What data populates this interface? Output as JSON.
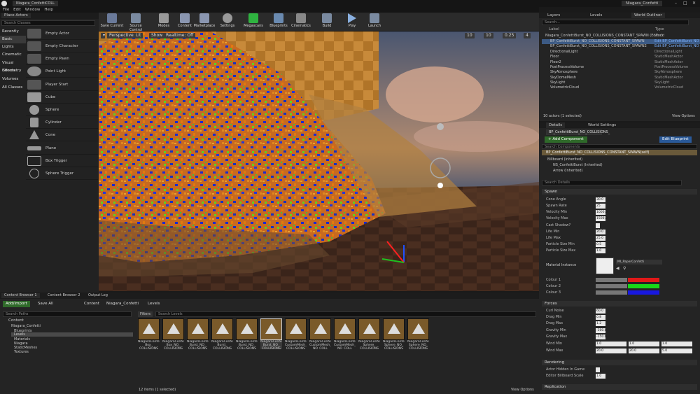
{
  "titlebar": {
    "tab": "Niagara_ConfettiCOLL",
    "app": "Niagara_Confetti"
  },
  "menu": [
    "File",
    "Edit",
    "Window",
    "Help"
  ],
  "place_actors": {
    "tab": "Place Actors",
    "search_placeholder": "Search Classes",
    "categories": [
      "Recently Placed",
      "Basic",
      "Lights",
      "Cinematic",
      "Visual Effects",
      "Geometry",
      "Volumes",
      "All Classes"
    ],
    "items": [
      "Empty Actor",
      "Empty Character",
      "Empty Pawn",
      "Point Light",
      "Player Start",
      "Cube",
      "Sphere",
      "Cylinder",
      "Cone",
      "Plane",
      "Box Trigger",
      "Sphere Trigger"
    ]
  },
  "toolbar": [
    "Save Current",
    "Source Control",
    "Modes",
    "Content",
    "Marketplace",
    "Settings",
    "Megascans",
    "Blueprints",
    "Cinematics",
    "Build",
    "Play",
    "Launch"
  ],
  "viewport": {
    "perspective": "Perspective",
    "lit": "Lit",
    "show": "Show",
    "realtime": "Realtime: Off",
    "snap1": "10",
    "snap2": "10",
    "snap3": "0.25",
    "snap4": "4"
  },
  "outliner": {
    "tabs": [
      "Layers",
      "Levels",
      "World Outliner"
    ],
    "search_placeholder": "Search...",
    "col_label": "Label",
    "col_type": "Type",
    "rows": [
      {
        "label": "Niagara_ConfettiBurst_NO_COLLISIONS_CONSTANT_SPAWN (Editor)",
        "type": "World"
      },
      {
        "label": "BP_ConfettiBurst_NO_COLLISIONS_CONSTANT_SPAWN",
        "type": "Edit BP_ConfettiBurst_NO"
      },
      {
        "label": "BP_ConfettiBurst_NO_COLLISIONS_CONSTANT_SPAWN2",
        "type": "Edit BP_ConfettiBurst_NO"
      },
      {
        "label": "DirectionalLight",
        "type": "DirectionalLight"
      },
      {
        "label": "Floor",
        "type": "StaticMeshActor"
      },
      {
        "label": "Floor2",
        "type": "StaticMeshActor"
      },
      {
        "label": "PostProcessVolume",
        "type": "PostProcessVolume"
      },
      {
        "label": "SkyAtmosphere",
        "type": "SkyAtmosphere"
      },
      {
        "label": "SkyDomeMesh",
        "type": "StaticMeshActor"
      },
      {
        "label": "SkyLight",
        "type": "SkyLight"
      },
      {
        "label": "VolumetricCloud",
        "type": "VolumetricCloud"
      }
    ],
    "count": "10 actors (1 selected)",
    "view_options": "View Options"
  },
  "details": {
    "tabs": [
      "Details",
      "World Settings"
    ],
    "name": "BP_ConfettiBurst_NO_COLLISIONS_",
    "add_component": "+ Add Component",
    "edit_blueprint": "Edit Blueprint",
    "search_comp_placeholder": "Search Components",
    "self_row": "BP_ConfettiBurst_NO_COLLISIONS_CONSTANT_SPAWN(self)",
    "components": [
      "Billboard (Inherited)",
      "NS_ConfettiBurst (Inherited)",
      "Arrow (Inherited)"
    ],
    "search_details_placeholder": "Search Details",
    "spawn_header": "Spawn",
    "spawn": [
      {
        "label": "Cone Angle",
        "value": "30.0"
      },
      {
        "label": "Spawn Rate",
        "value": "25"
      },
      {
        "label": "Velocity Min",
        "value": "1000.0"
      },
      {
        "label": "Velocity Max",
        "value": "1500.0"
      },
      {
        "label": "Cast Shadow?",
        "value": ""
      },
      {
        "label": "Life Min",
        "value": "20.0"
      },
      {
        "label": "Life Max",
        "value": "25.0"
      },
      {
        "label": "Particle Size Min",
        "value": "0.5"
      },
      {
        "label": "Particle Size Max",
        "value": "1.0"
      }
    ],
    "material_label": "Material Instance",
    "material_value": "MI_PaperConfetti",
    "colours": [
      "Colour 1",
      "Colour 2",
      "Colour 3"
    ],
    "colour_hex": [
      "#e01818",
      "#18d818",
      "#1818e0"
    ],
    "forces_header": "Forces",
    "forces": [
      {
        "label": "Curl Noise",
        "value": "60.0"
      },
      {
        "label": "Drag Min",
        "value": "0.8"
      },
      {
        "label": "Drag Max",
        "value": "1.2"
      },
      {
        "label": "Gravity Min",
        "value": "-100.0"
      },
      {
        "label": "Gravity Max",
        "value": "-150.0"
      }
    ],
    "wind_min": {
      "label": "Wind Min",
      "x": "1.0",
      "y": "1.0",
      "z": "1.0"
    },
    "wind_max": {
      "label": "Wind Max",
      "x": "20.0",
      "y": "20.0",
      "z": "5.0"
    },
    "rendering_header": "Rendering",
    "rendering": [
      {
        "label": "Actor Hidden In Game",
        "value": ""
      },
      {
        "label": "Editor Billboard Scale",
        "value": "1.0"
      }
    ],
    "replication_header": "Replication"
  },
  "content_browser": {
    "tabs": [
      "Content Browser 1",
      "Content Browser 2",
      "Output Log"
    ],
    "add_import": "Add/Import",
    "save_all": "Save All",
    "path": [
      "Content",
      "Niagara_Confetti",
      "Levels"
    ],
    "search_paths_placeholder": "Search Paths",
    "filters": "Filters",
    "search_levels_placeholder": "Search Levels",
    "tree": [
      "Content",
      "Niagara_Confetti",
      "Blueprints",
      "Levels",
      "Materials",
      "Niagara",
      "StaticMeshes",
      "Textures"
    ],
    "assets": [
      "NiagaraConfetti\nBox_\nCOLLISIONS",
      "NiagaraConfetti\nBox_NO_\nCOLLISIONS",
      "NiagaraConfetti\nBurst_NO_\nCOLLISIONS",
      "NiagaraConfetti\nBurst_\nCOLLISIONS",
      "NiagaraConfetti\nBurst_NO_\nCOLLISIONS",
      "NiagaraConfetti\nBurst_NO_\nCOLLISIONS",
      "NiagaraConfetti\nCustomMesh_\nCOLLISIONS",
      "NiagaraConfetti\nCustomMesh_\nNO_COLL",
      "NiagaraConfetti\nCustomMesh_\nNO_COLL",
      "NiagaraConfetti\nSphere_\nCOLLISIONS",
      "NiagaraConfetti\nSphere_NO_\nCOLLISIONS",
      "NiagaraConfetti\nSphere_NO_\nCOLLISIONS"
    ],
    "count": "12 items (1 selected)",
    "view_options": "View Options"
  }
}
